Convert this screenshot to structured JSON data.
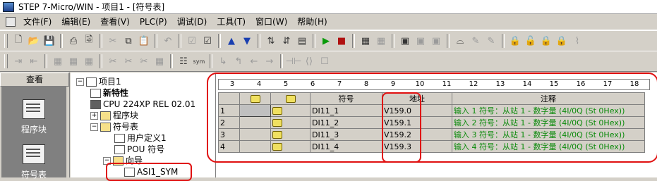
{
  "window": {
    "title": "STEP 7-Micro/WIN - 项目1 - [符号表]"
  },
  "menu": [
    "文件(F)",
    "编辑(E)",
    "查看(V)",
    "PLC(P)",
    "调试(D)",
    "工具(T)",
    "窗口(W)",
    "帮助(H)"
  ],
  "toolbar": {
    "sym_label": "sym"
  },
  "nav": {
    "header": "查看",
    "program_block": "程序块",
    "symbol_table": "符号表"
  },
  "tree": {
    "project": "项目1",
    "new_features": "新特性",
    "cpu": "CPU 224XP REL 02.01",
    "program_block": "程序块",
    "symbol_table": "符号表",
    "user_defined": "用户定义1",
    "pou_symbols": "POU 符号",
    "wizard": "向导",
    "asi": "ASI1_SYM"
  },
  "ruler": [
    "3",
    "4",
    "5",
    "6",
    "7",
    "8",
    "9",
    "10",
    "11",
    "12",
    "13",
    "14",
    "15",
    "16",
    "17",
    "18"
  ],
  "table": {
    "headers": {
      "symbol": "符号",
      "address": "地址",
      "comment": "注释"
    },
    "rows": [
      {
        "num": "1",
        "symbol": "DI11_1",
        "address": "V159.0",
        "comment": "输入 1 符号：从站 1 - 数字量 (4I/0Q (St 0Hex))"
      },
      {
        "num": "2",
        "symbol": "DI11_2",
        "address": "V159.1",
        "comment": "输入 2 符号：从站 1 - 数字量 (4I/0Q (St 0Hex))"
      },
      {
        "num": "3",
        "symbol": "DI11_3",
        "address": "V159.2",
        "comment": "输入 3 符号：从站 1 - 数字量 (4I/0Q (St 0Hex))"
      },
      {
        "num": "4",
        "symbol": "DI11_4",
        "address": "V159.3",
        "comment": "输入 4 符号：从站 1 - 数字量 (4I/0Q (St 0Hex))"
      }
    ]
  },
  "colors": {
    "highlight": "#e01010",
    "comment_text": "#0a8a0a"
  }
}
